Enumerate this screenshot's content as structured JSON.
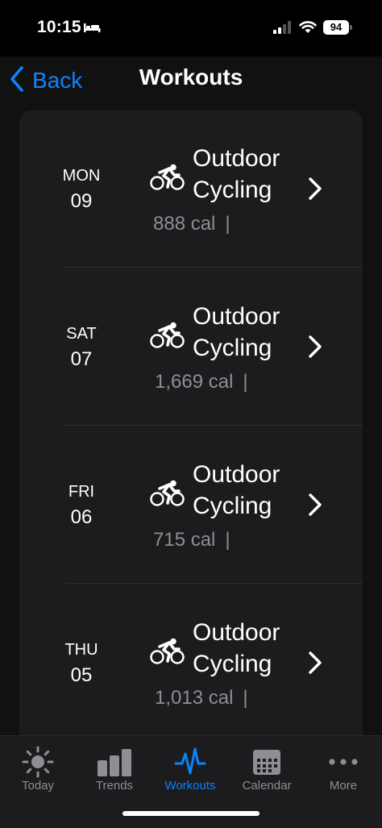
{
  "status": {
    "time": "10:15",
    "battery": "94",
    "icons": [
      "bed-icon",
      "cellular-signal-icon",
      "wifi-icon",
      "battery-icon"
    ]
  },
  "nav": {
    "back_label": "Back",
    "title": "Workouts"
  },
  "workouts": [
    {
      "day": "MON",
      "date": "09",
      "name_line1": "Outdoor",
      "name_line2": "Cycling",
      "calories": "888 cal",
      "divider": "|",
      "icon": "cycling-icon"
    },
    {
      "day": "SAT",
      "date": "07",
      "name_line1": "Outdoor",
      "name_line2": "Cycling",
      "calories": "1,669 cal",
      "divider": "|",
      "icon": "cycling-icon"
    },
    {
      "day": "FRI",
      "date": "06",
      "name_line1": "Outdoor",
      "name_line2": "Cycling",
      "calories": "715 cal",
      "divider": "|",
      "icon": "cycling-icon"
    },
    {
      "day": "THU",
      "date": "05",
      "name_line1": "Outdoor",
      "name_line2": "Cycling",
      "calories": "1,013 cal",
      "divider": "|",
      "icon": "cycling-icon"
    }
  ],
  "tabs": [
    {
      "label": "Today",
      "icon": "sun-icon",
      "active": false
    },
    {
      "label": "Trends",
      "icon": "bar-chart-icon",
      "active": false
    },
    {
      "label": "Workouts",
      "icon": "pulse-icon",
      "active": true
    },
    {
      "label": "Calendar",
      "icon": "calendar-icon",
      "active": false
    },
    {
      "label": "More",
      "icon": "ellipsis-icon",
      "active": false
    }
  ],
  "colors": {
    "accent": "#0a84ff",
    "background": "#000000",
    "card": "#1c1c1e",
    "secondary_text": "#8e8e93"
  }
}
